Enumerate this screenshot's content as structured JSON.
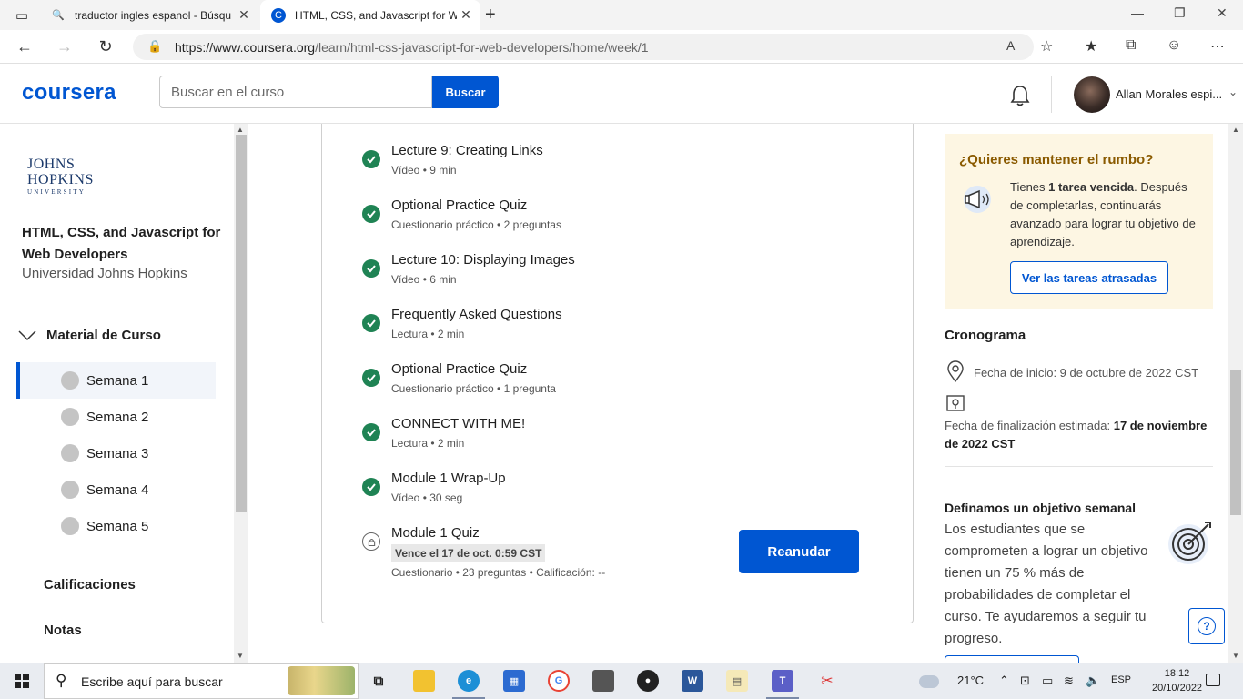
{
  "browser": {
    "tabs": [
      {
        "title": "traductor ingles espanol - Búsqu",
        "active": false
      },
      {
        "title": "HTML, CSS, and Javascript for We",
        "active": true
      }
    ],
    "new_tab": "+",
    "url_host": "https://www.coursera.org",
    "url_path": "/learn/html-css-javascript-for-web-developers/home/week/1"
  },
  "header": {
    "logo": "coursera",
    "search_placeholder": "Buscar en el curso",
    "search_button": "Buscar",
    "user_name": "Allan Morales espi..."
  },
  "sidebar": {
    "university_logo_line1": "JOHNS",
    "university_logo_line2": "HOPKINS",
    "university_logo_line3": "UNIVERSITY",
    "course_title": "HTML, CSS, and Javascript for Web Developers",
    "course_org": "Universidad Johns Hopkins",
    "material_label": "Material de Curso",
    "weeks": [
      {
        "label": "Semana 1",
        "selected": true
      },
      {
        "label": "Semana 2",
        "selected": false
      },
      {
        "label": "Semana 3",
        "selected": false
      },
      {
        "label": "Semana 4",
        "selected": false
      },
      {
        "label": "Semana 5",
        "selected": false
      }
    ],
    "grades_label": "Calificaciones",
    "notes_label": "Notas"
  },
  "main": {
    "items": [
      {
        "title": "Lecture 9: Creating Links",
        "meta": "Vídeo • 9 min",
        "status": "completed"
      },
      {
        "title": "Optional Practice Quiz",
        "meta": "Cuestionario práctico • 2 preguntas",
        "status": "completed"
      },
      {
        "title": "Lecture 10: Displaying Images",
        "meta": "Vídeo • 6 min",
        "status": "completed"
      },
      {
        "title": "Frequently Asked Questions",
        "meta": "Lectura • 2 min",
        "status": "completed"
      },
      {
        "title": "Optional Practice Quiz",
        "meta": "Cuestionario práctico • 1 pregunta",
        "status": "completed"
      },
      {
        "title": "CONNECT WITH ME!",
        "meta": "Lectura • 2 min",
        "status": "completed"
      },
      {
        "title": "Module 1 Wrap-Up",
        "meta": "Vídeo • 30 seg",
        "status": "completed"
      }
    ],
    "quiz": {
      "title": "Module 1 Quiz",
      "due": "Vence el 17 de oct. 0:59 CST",
      "meta": "Cuestionario • 23 preguntas • Calificación: --",
      "button": "Reanudar",
      "status": "locked"
    }
  },
  "right": {
    "rumbo_title": "¿Quieres mantener el rumbo?",
    "rumbo_text_pre": "Tienes ",
    "rumbo_text_bold": "1 tarea vencida",
    "rumbo_text_post": ". Después de completarlas, continuarás avanzado para lograr tu objetivo de aprendizaje.",
    "rumbo_button": "Ver las tareas atrasadas",
    "schedule_title": "Cronograma",
    "start_date": "Fecha de inicio: 9 de octubre de 2022 CST",
    "end_date_label": "Fecha de finalización estimada: ",
    "end_date_value": "17 de noviembre de 2022 CST",
    "goal_title": "Definamos un objetivo semanal",
    "goal_text": "Los estudiantes que se comprometen a lograr un objetivo tienen un 75 % más de probabilidades de completar el curso. Te ayudaremos a seguir tu progreso.",
    "help": "?"
  },
  "taskbar": {
    "search_placeholder": "Escribe aquí para buscar",
    "weather": "21°C",
    "language": "ESP",
    "time": "18:12",
    "date": "20/10/2022"
  },
  "colors": {
    "brand": "#0056d2",
    "check": "#1f8354",
    "banner": "#fdf6e3"
  }
}
